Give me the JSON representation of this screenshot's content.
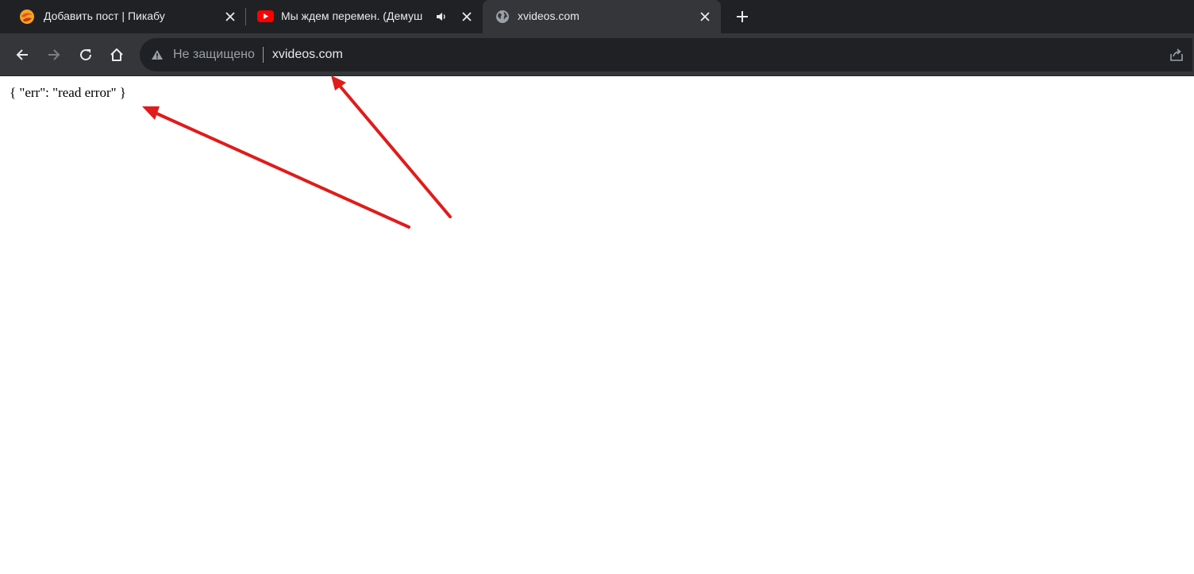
{
  "tabs": [
    {
      "title": "Добавить пост | Пикабу",
      "icon": "pikabu-favicon-icon",
      "active": false
    },
    {
      "title": "Мы ждем перемен. (Демуш",
      "icon": "youtube-favicon-icon",
      "audio": true,
      "active": false
    },
    {
      "title": "xvideos.com",
      "icon": "globe-icon",
      "active": true
    }
  ],
  "omnibox": {
    "security_label": "Не защищено",
    "url": "xvideos.com"
  },
  "page": {
    "body_text": "{ \"err\": \"read error\" }"
  },
  "colors": {
    "tabstrip_bg": "#202124",
    "toolbar_bg": "#35363a",
    "omnibox_bg": "#202124",
    "annotation_arrow": "#e01b1b"
  }
}
